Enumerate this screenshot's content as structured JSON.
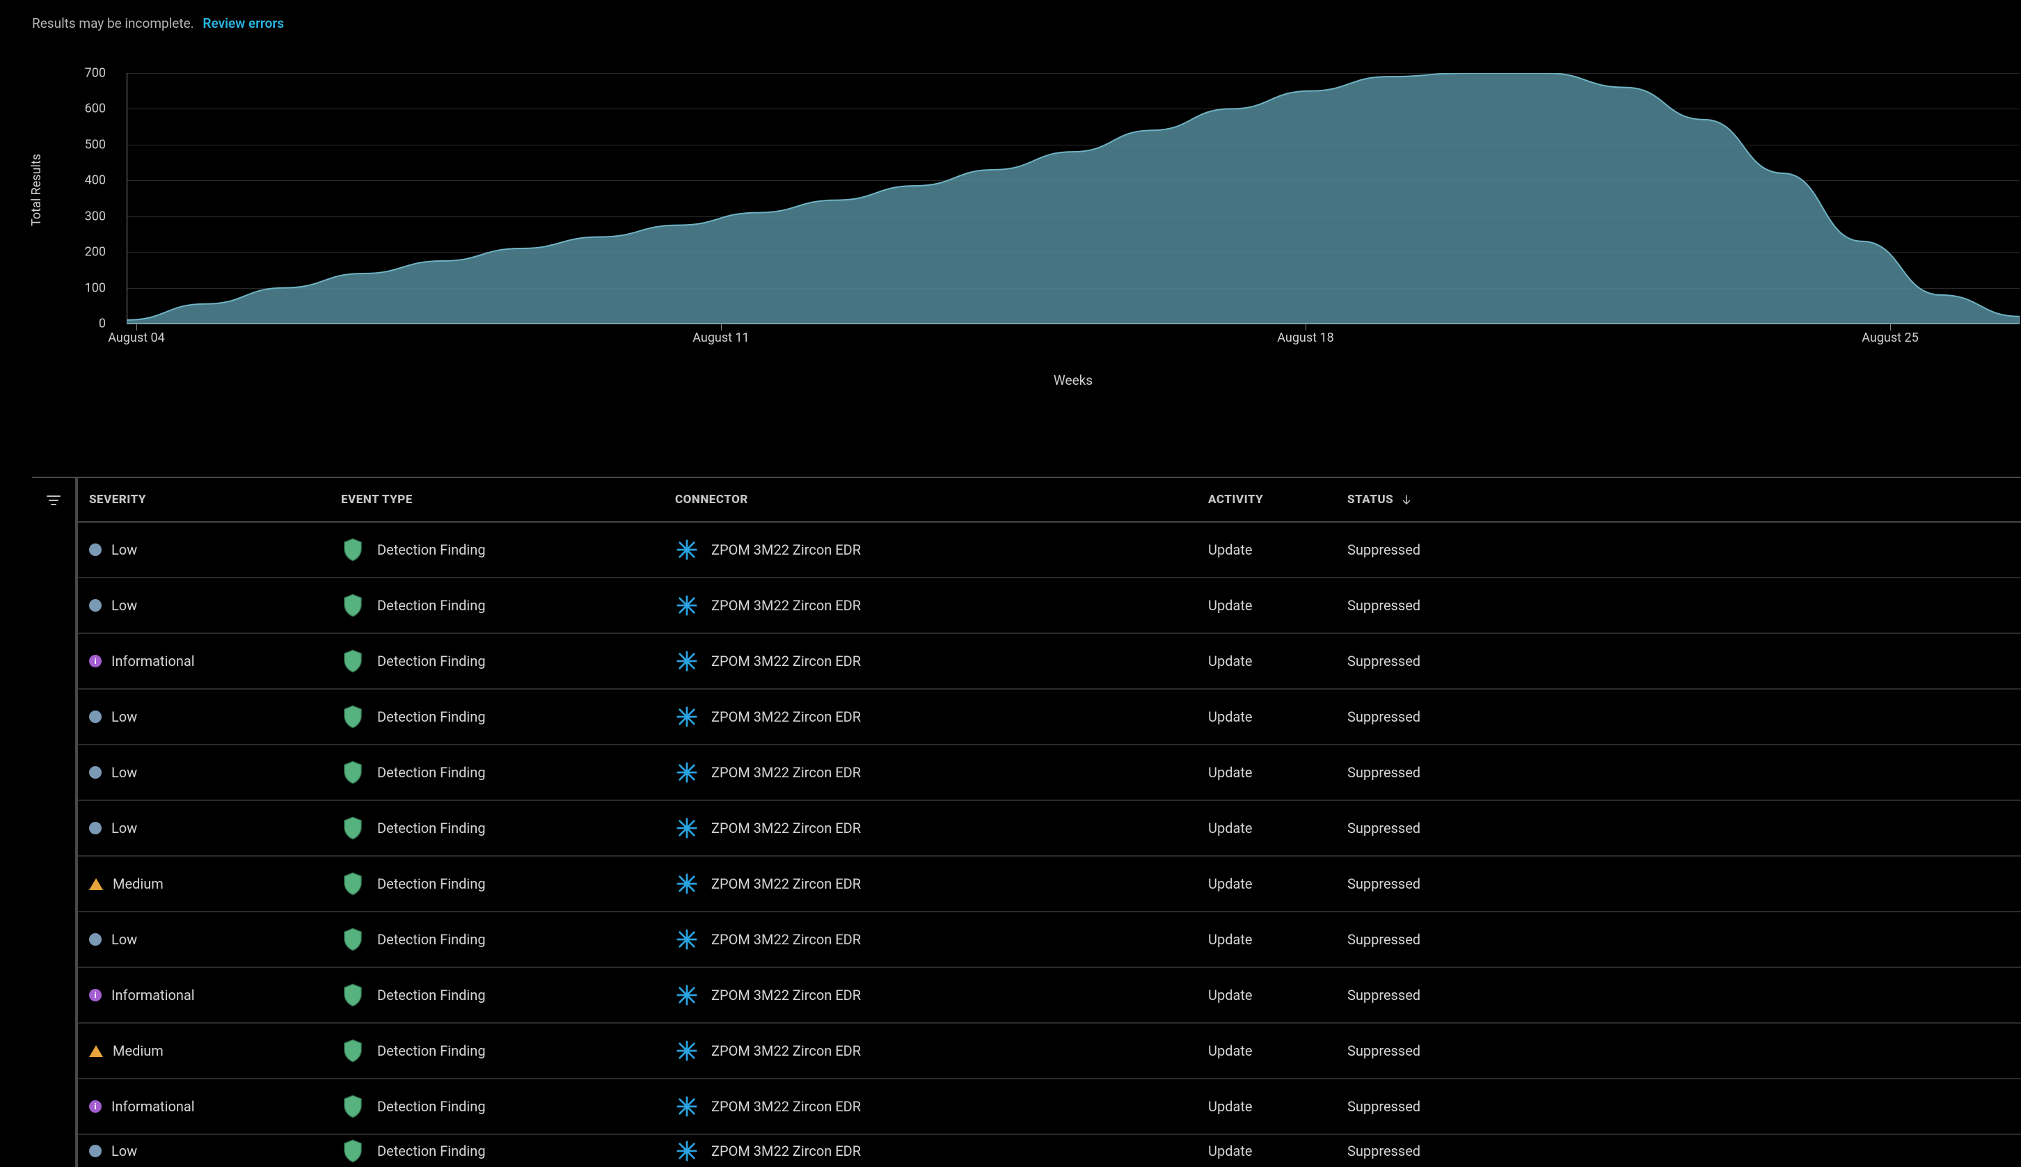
{
  "banner": {
    "text": "Results may be incomplete.",
    "link_label": "Review errors"
  },
  "chart_data": {
    "type": "area",
    "title": "",
    "xlabel": "Weeks",
    "ylabel": "Total Results",
    "ylim": [
      0,
      700
    ],
    "y_ticks": [
      0,
      100,
      200,
      300,
      400,
      500,
      600,
      700
    ],
    "x_categories": [
      "August 04",
      "August 11",
      "August 18",
      "August 25"
    ],
    "series": [
      {
        "name": "Total Results",
        "x": [
          "August 04",
          "August 05",
          "August 06",
          "August 07",
          "August 08",
          "August 09",
          "August 10",
          "August 11",
          "August 12",
          "August 13",
          "August 14",
          "August 15",
          "August 16",
          "August 17",
          "August 18",
          "August 19",
          "August 20",
          "August 21",
          "August 22",
          "August 23",
          "August 24",
          "August 25",
          "August 26",
          "August 27",
          "August 28"
        ],
        "values": [
          10,
          55,
          100,
          140,
          175,
          210,
          242,
          275,
          310,
          345,
          385,
          430,
          480,
          540,
          600,
          650,
          690,
          710,
          700,
          660,
          570,
          420,
          230,
          80,
          20
        ]
      }
    ]
  },
  "table": {
    "columns": {
      "severity": "SEVERITY",
      "event_type": "EVENT TYPE",
      "connector": "CONNECTOR",
      "activity": "ACTIVITY",
      "status": "STATUS"
    },
    "sort_column": "status",
    "sort_direction": "desc",
    "connector_icon": "snowflake-icon",
    "event_icon": "shield-icon",
    "rows": [
      {
        "severity_level": "low",
        "severity_label": "Low",
        "event_type": "Detection Finding",
        "connector": "ZPOM 3M22 Zircon EDR",
        "activity": "Update",
        "status": "Suppressed"
      },
      {
        "severity_level": "low",
        "severity_label": "Low",
        "event_type": "Detection Finding",
        "connector": "ZPOM 3M22 Zircon EDR",
        "activity": "Update",
        "status": "Suppressed"
      },
      {
        "severity_level": "informational",
        "severity_label": "Informational",
        "event_type": "Detection Finding",
        "connector": "ZPOM 3M22 Zircon EDR",
        "activity": "Update",
        "status": "Suppressed"
      },
      {
        "severity_level": "low",
        "severity_label": "Low",
        "event_type": "Detection Finding",
        "connector": "ZPOM 3M22 Zircon EDR",
        "activity": "Update",
        "status": "Suppressed"
      },
      {
        "severity_level": "low",
        "severity_label": "Low",
        "event_type": "Detection Finding",
        "connector": "ZPOM 3M22 Zircon EDR",
        "activity": "Update",
        "status": "Suppressed"
      },
      {
        "severity_level": "low",
        "severity_label": "Low",
        "event_type": "Detection Finding",
        "connector": "ZPOM 3M22 Zircon EDR",
        "activity": "Update",
        "status": "Suppressed"
      },
      {
        "severity_level": "medium",
        "severity_label": "Medium",
        "event_type": "Detection Finding",
        "connector": "ZPOM 3M22 Zircon EDR",
        "activity": "Update",
        "status": "Suppressed"
      },
      {
        "severity_level": "low",
        "severity_label": "Low",
        "event_type": "Detection Finding",
        "connector": "ZPOM 3M22 Zircon EDR",
        "activity": "Update",
        "status": "Suppressed"
      },
      {
        "severity_level": "informational",
        "severity_label": "Informational",
        "event_type": "Detection Finding",
        "connector": "ZPOM 3M22 Zircon EDR",
        "activity": "Update",
        "status": "Suppressed"
      },
      {
        "severity_level": "medium",
        "severity_label": "Medium",
        "event_type": "Detection Finding",
        "connector": "ZPOM 3M22 Zircon EDR",
        "activity": "Update",
        "status": "Suppressed"
      },
      {
        "severity_level": "informational",
        "severity_label": "Informational",
        "event_type": "Detection Finding",
        "connector": "ZPOM 3M22 Zircon EDR",
        "activity": "Update",
        "status": "Suppressed"
      },
      {
        "severity_level": "low",
        "severity_label": "Low",
        "event_type": "Detection Finding",
        "connector": "ZPOM 3M22 Zircon EDR",
        "activity": "Update",
        "status": "Suppressed"
      }
    ]
  }
}
